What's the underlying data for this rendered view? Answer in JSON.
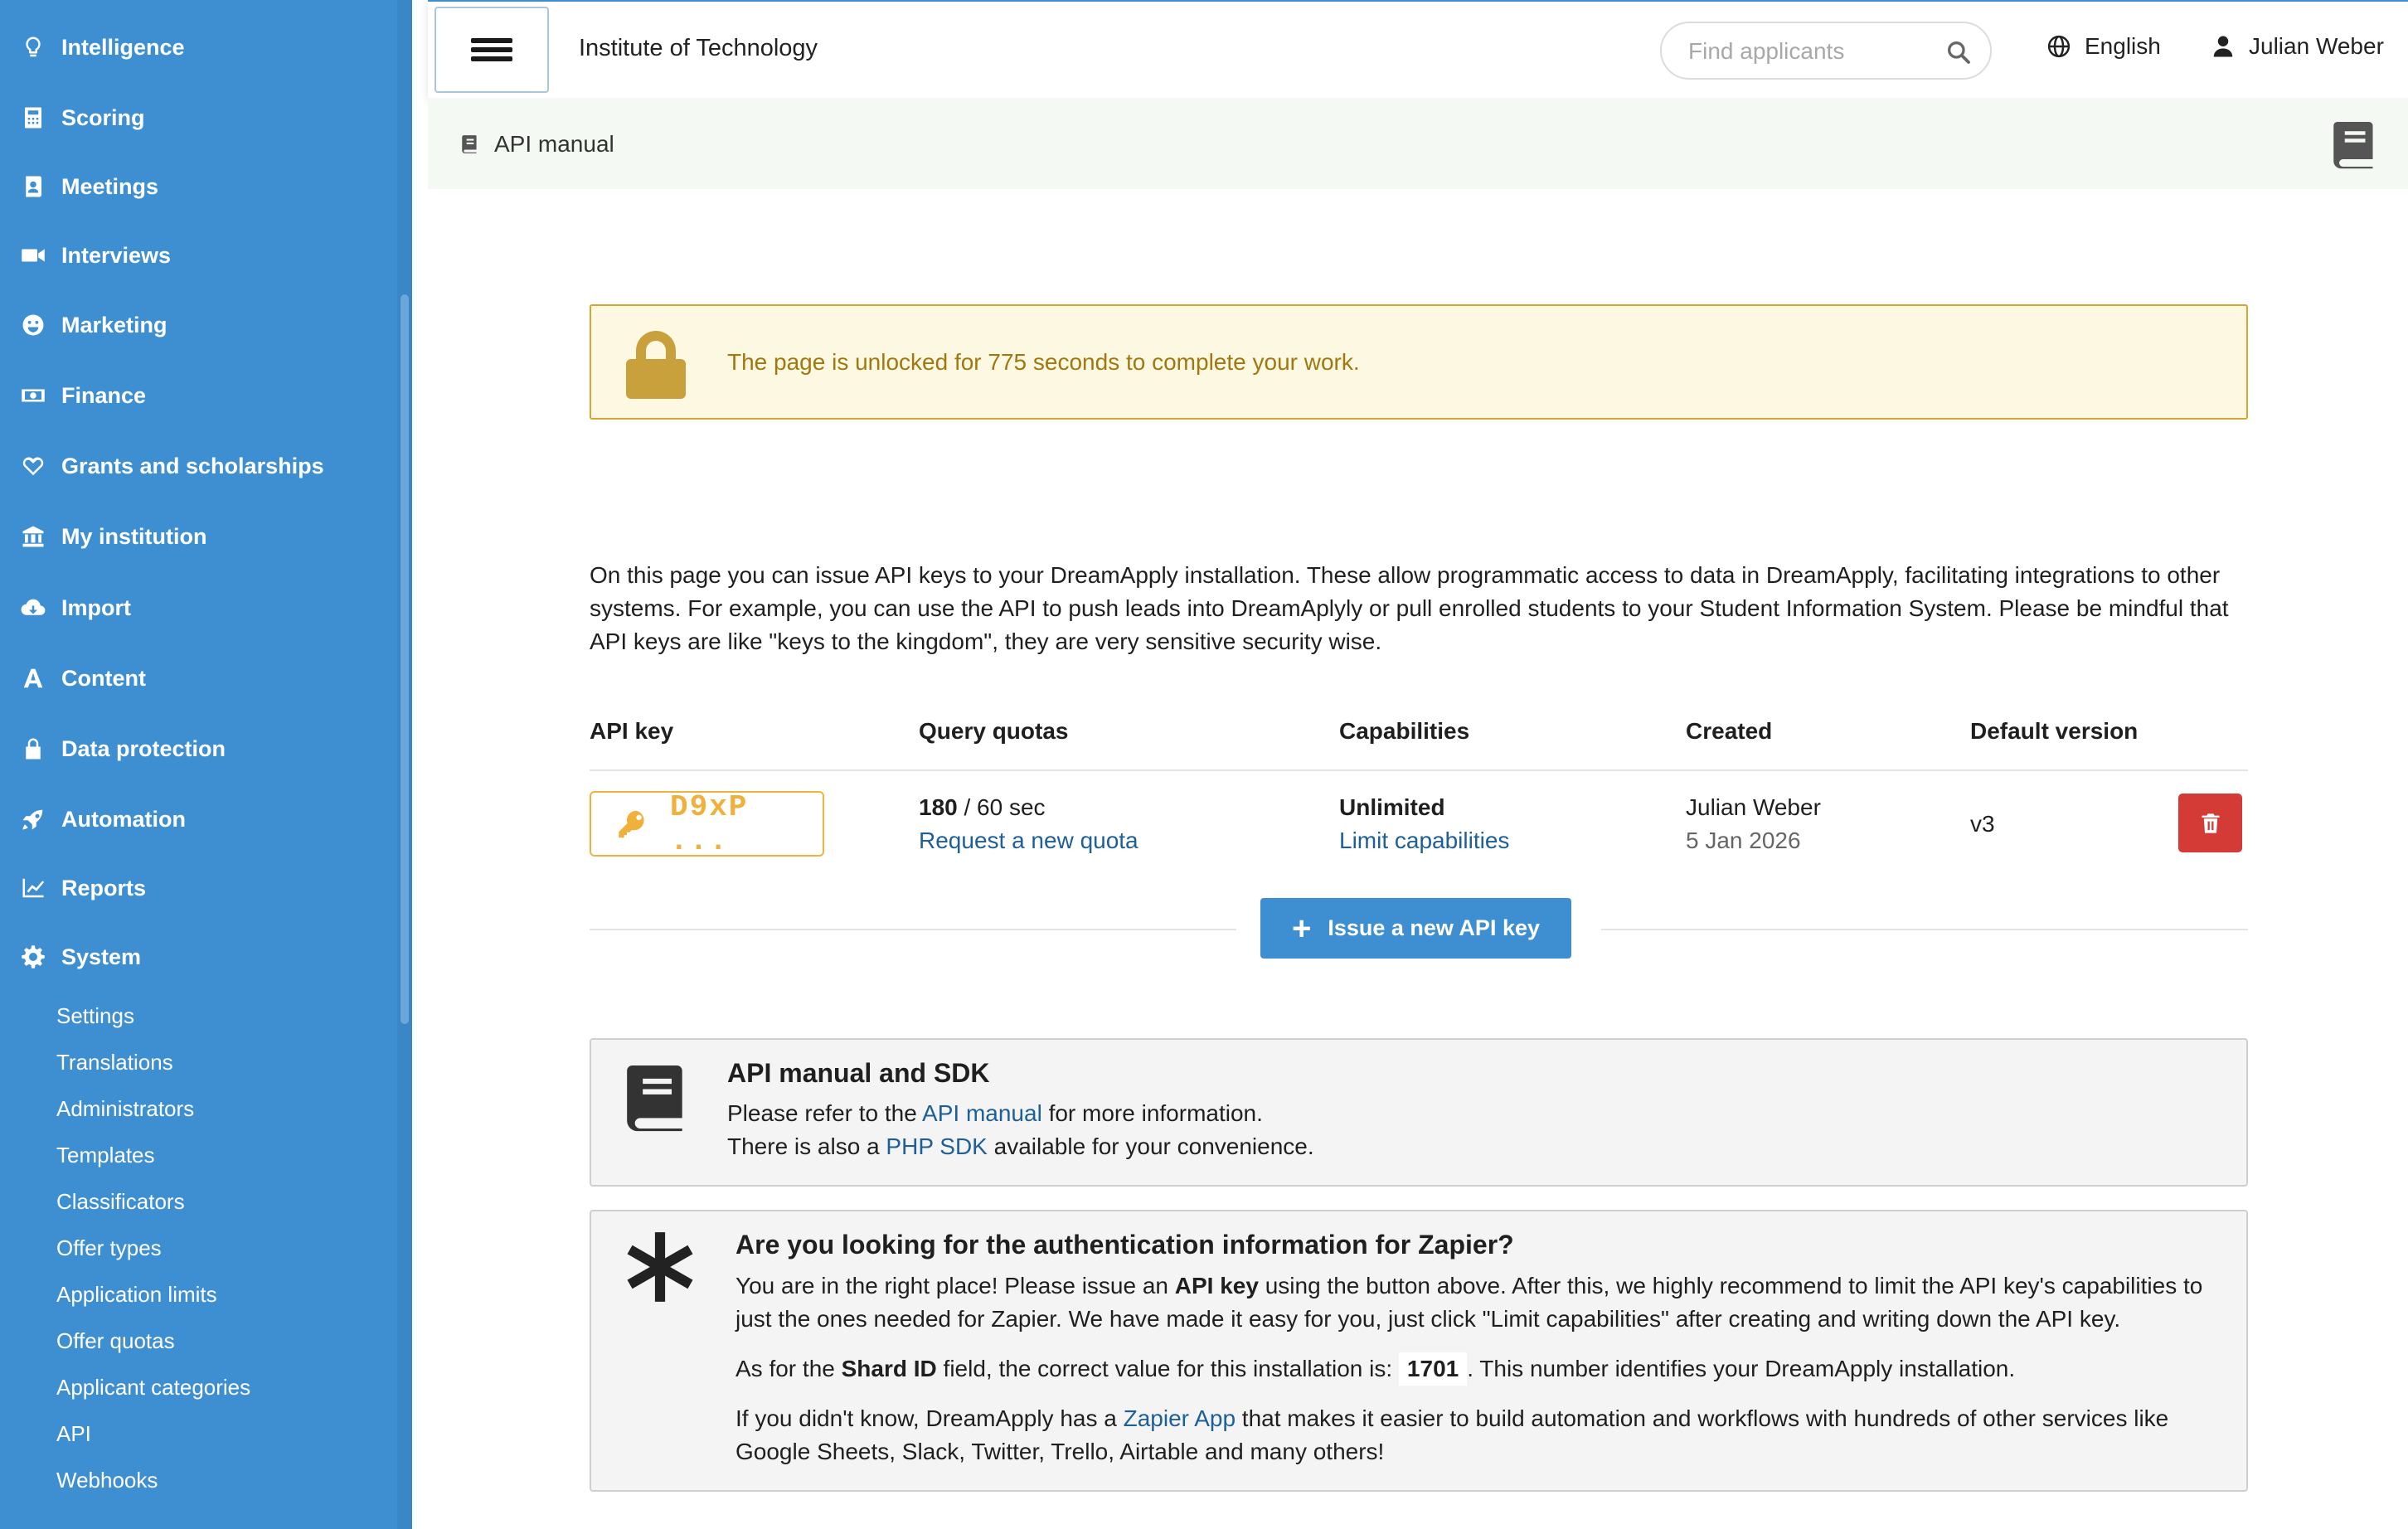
{
  "sidebar": {
    "items": [
      {
        "label": "Intelligence",
        "icon": "lightbulb-icon"
      },
      {
        "label": "Scoring",
        "icon": "calculator-icon"
      },
      {
        "label": "Meetings",
        "icon": "contact-book-icon"
      },
      {
        "label": "Interviews",
        "icon": "video-camera-icon"
      },
      {
        "label": "Marketing",
        "icon": "smiley-icon"
      },
      {
        "label": "Finance",
        "icon": "banknote-icon"
      },
      {
        "label": "Grants and scholarships",
        "icon": "heart-icon"
      },
      {
        "label": "My institution",
        "icon": "bank-building-icon"
      },
      {
        "label": "Import",
        "icon": "cloud-download-icon"
      },
      {
        "label": "Content",
        "icon": "letter-a-icon"
      },
      {
        "label": "Data protection",
        "icon": "lock-icon"
      },
      {
        "label": "Automation",
        "icon": "rocket-icon"
      },
      {
        "label": "Reports",
        "icon": "line-chart-icon"
      },
      {
        "label": "System",
        "icon": "gear-icon"
      }
    ],
    "system_sub": [
      "Settings",
      "Translations",
      "Administrators",
      "Templates",
      "Classificators",
      "Offer types",
      "Application limits",
      "Offer quotas",
      "Applicant categories",
      "API",
      "Webhooks"
    ]
  },
  "header": {
    "institution": "Institute of Technology",
    "search_placeholder": "Find applicants",
    "language": "English",
    "user": "Julian Weber"
  },
  "breadcrumb": {
    "label": "API manual"
  },
  "unlock_notice": "The page is unlocked for 775 seconds to complete your work.",
  "intro": "On this page you can issue API keys to your DreamApply installation. These allow programmatic access to data in DreamApply, facilitating integrations to other systems. For example, you can use the API to push leads into DreamAplyly or pull enrolled students to your Student Information System. Please be mindful that API keys are like \"keys to the kingdom\", they are very sensitive security wise.",
  "table": {
    "headers": [
      "API key",
      "Query quotas",
      "Capabilities",
      "Created",
      "Default version"
    ],
    "row": {
      "key": "D9xP ...",
      "quota_value": "180",
      "quota_rest": " / 60 sec",
      "quota_link": "Request a new quota",
      "capabilities": "Unlimited",
      "capabilities_link": "Limit capabilities",
      "created_by": "Julian Weber",
      "created_date": "5 Jan 2026",
      "version": "v3"
    }
  },
  "issue_button": "Issue a new API key",
  "sdk_panel": {
    "title": "API manual and SDK",
    "line1_pre": "Please refer to the ",
    "line1_link": "API manual",
    "line1_post": " for more information.",
    "line2_pre": "There is also a ",
    "line2_link": "PHP SDK",
    "line2_post": " available for your convenience."
  },
  "zapier_panel": {
    "title": "Are you looking for the authentication information for Zapier?",
    "p1_pre": "You are in the right place! Please issue an ",
    "p1_bold": "API key",
    "p1_post": " using the button above. After this, we highly recommend to limit the API key's capabilities to just the ones needed for Zapier. We have made it easy for you, just click \"Limit capabilities\" after creating and writing down the API key.",
    "p2_pre": "As for the ",
    "p2_bold": "Shard ID",
    "p2_mid": " field, the correct value for this installation is: ",
    "shard_id": "1701",
    "p2_post": ". This number identifies your DreamApply installation.",
    "p3_pre": "If you didn't know, DreamApply has a ",
    "p3_link": "Zapier App",
    "p3_post": " that makes it easier to build automation and workflows with hundreds of other services like Google Sheets, Slack, Twitter, Trello, Airtable and many others!"
  },
  "colors": {
    "sidebar": "#3e8fd2",
    "accent_button": "#3e8fd2",
    "warning_border": "#d4a734",
    "warning_text": "#a0780f",
    "delete": "#d43a36",
    "key_chip": "#efb03c",
    "link": "#1d5f98"
  }
}
